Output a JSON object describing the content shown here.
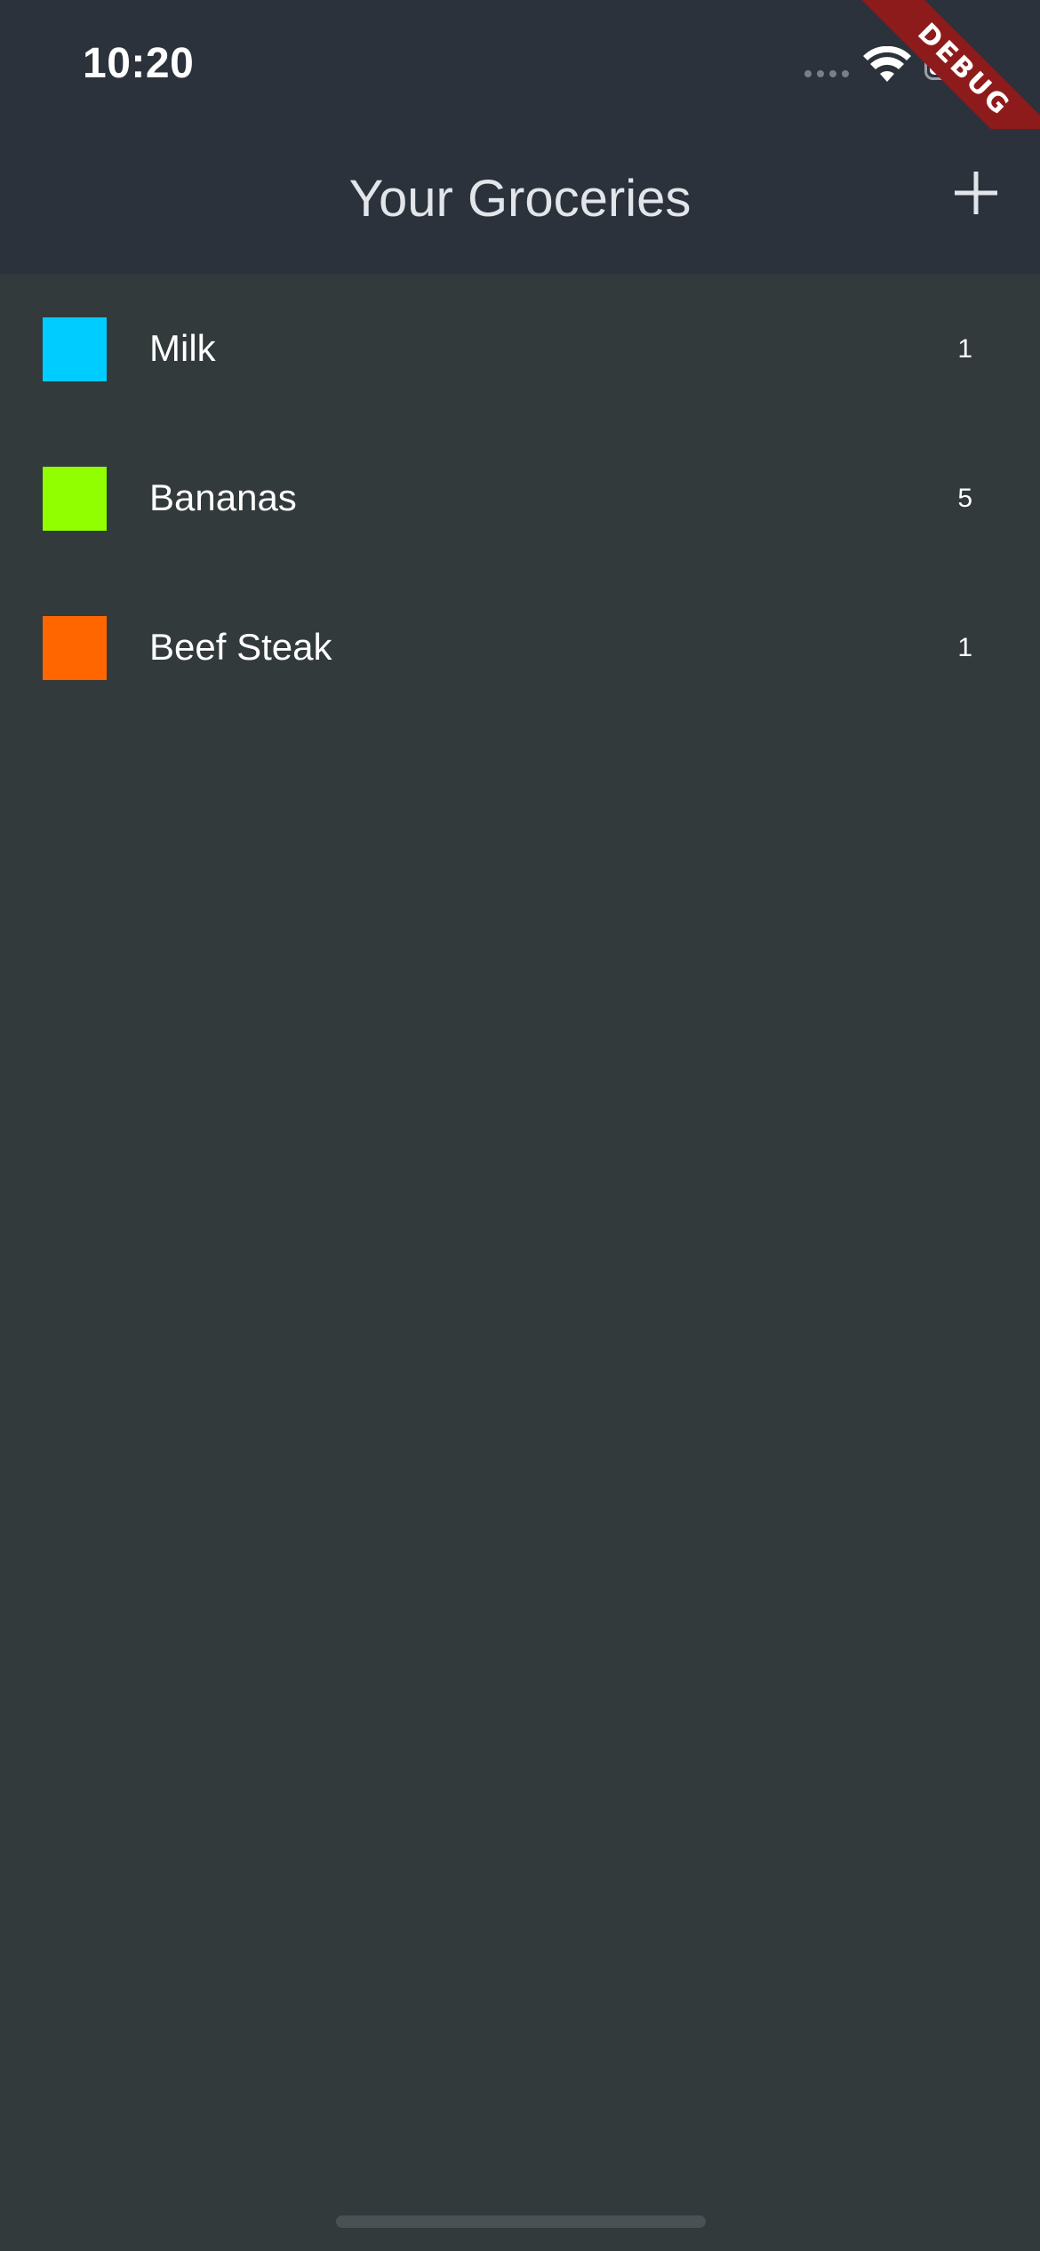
{
  "status_bar": {
    "time": "10:20"
  },
  "app_bar": {
    "title": "Your Groceries",
    "add_icon": "plus-icon"
  },
  "groceries": [
    {
      "name": "Milk",
      "quantity": "1",
      "color": "#00ccff"
    },
    {
      "name": "Bananas",
      "quantity": "5",
      "color": "#91ff00"
    },
    {
      "name": "Beef Steak",
      "quantity": "1",
      "color": "#ff6600"
    }
  ],
  "debug_banner": "DEBUG",
  "colors": {
    "app_bar_bg": "#2b323c",
    "body_bg": "#323a3c"
  }
}
